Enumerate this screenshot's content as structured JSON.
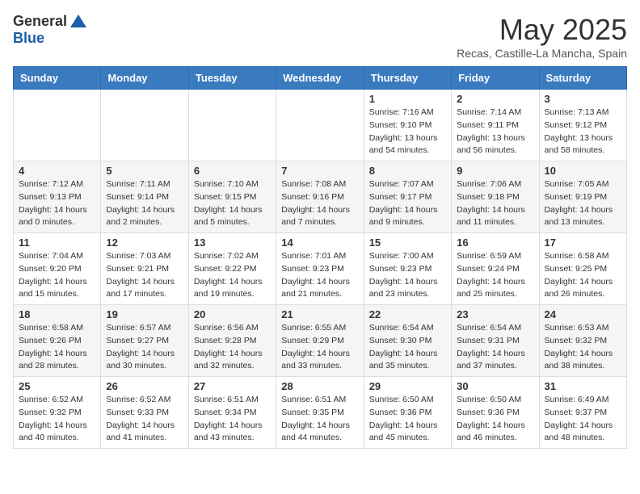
{
  "logo": {
    "general": "General",
    "blue": "Blue"
  },
  "title": "May 2025",
  "subtitle": "Recas, Castille-La Mancha, Spain",
  "days_of_week": [
    "Sunday",
    "Monday",
    "Tuesday",
    "Wednesday",
    "Thursday",
    "Friday",
    "Saturday"
  ],
  "weeks": [
    [
      {
        "day": "",
        "info": ""
      },
      {
        "day": "",
        "info": ""
      },
      {
        "day": "",
        "info": ""
      },
      {
        "day": "",
        "info": ""
      },
      {
        "day": "1",
        "sunrise": "7:16 AM",
        "sunset": "9:10 PM",
        "daylight": "13 hours and 54 minutes."
      },
      {
        "day": "2",
        "sunrise": "7:14 AM",
        "sunset": "9:11 PM",
        "daylight": "13 hours and 56 minutes."
      },
      {
        "day": "3",
        "sunrise": "7:13 AM",
        "sunset": "9:12 PM",
        "daylight": "13 hours and 58 minutes."
      }
    ],
    [
      {
        "day": "4",
        "sunrise": "7:12 AM",
        "sunset": "9:13 PM",
        "daylight": "14 hours and 0 minutes."
      },
      {
        "day": "5",
        "sunrise": "7:11 AM",
        "sunset": "9:14 PM",
        "daylight": "14 hours and 2 minutes."
      },
      {
        "day": "6",
        "sunrise": "7:10 AM",
        "sunset": "9:15 PM",
        "daylight": "14 hours and 5 minutes."
      },
      {
        "day": "7",
        "sunrise": "7:08 AM",
        "sunset": "9:16 PM",
        "daylight": "14 hours and 7 minutes."
      },
      {
        "day": "8",
        "sunrise": "7:07 AM",
        "sunset": "9:17 PM",
        "daylight": "14 hours and 9 minutes."
      },
      {
        "day": "9",
        "sunrise": "7:06 AM",
        "sunset": "9:18 PM",
        "daylight": "14 hours and 11 minutes."
      },
      {
        "day": "10",
        "sunrise": "7:05 AM",
        "sunset": "9:19 PM",
        "daylight": "14 hours and 13 minutes."
      }
    ],
    [
      {
        "day": "11",
        "sunrise": "7:04 AM",
        "sunset": "9:20 PM",
        "daylight": "14 hours and 15 minutes."
      },
      {
        "day": "12",
        "sunrise": "7:03 AM",
        "sunset": "9:21 PM",
        "daylight": "14 hours and 17 minutes."
      },
      {
        "day": "13",
        "sunrise": "7:02 AM",
        "sunset": "9:22 PM",
        "daylight": "14 hours and 19 minutes."
      },
      {
        "day": "14",
        "sunrise": "7:01 AM",
        "sunset": "9:23 PM",
        "daylight": "14 hours and 21 minutes."
      },
      {
        "day": "15",
        "sunrise": "7:00 AM",
        "sunset": "9:23 PM",
        "daylight": "14 hours and 23 minutes."
      },
      {
        "day": "16",
        "sunrise": "6:59 AM",
        "sunset": "9:24 PM",
        "daylight": "14 hours and 25 minutes."
      },
      {
        "day": "17",
        "sunrise": "6:58 AM",
        "sunset": "9:25 PM",
        "daylight": "14 hours and 26 minutes."
      }
    ],
    [
      {
        "day": "18",
        "sunrise": "6:58 AM",
        "sunset": "9:26 PM",
        "daylight": "14 hours and 28 minutes."
      },
      {
        "day": "19",
        "sunrise": "6:57 AM",
        "sunset": "9:27 PM",
        "daylight": "14 hours and 30 minutes."
      },
      {
        "day": "20",
        "sunrise": "6:56 AM",
        "sunset": "9:28 PM",
        "daylight": "14 hours and 32 minutes."
      },
      {
        "day": "21",
        "sunrise": "6:55 AM",
        "sunset": "9:29 PM",
        "daylight": "14 hours and 33 minutes."
      },
      {
        "day": "22",
        "sunrise": "6:54 AM",
        "sunset": "9:30 PM",
        "daylight": "14 hours and 35 minutes."
      },
      {
        "day": "23",
        "sunrise": "6:54 AM",
        "sunset": "9:31 PM",
        "daylight": "14 hours and 37 minutes."
      },
      {
        "day": "24",
        "sunrise": "6:53 AM",
        "sunset": "9:32 PM",
        "daylight": "14 hours and 38 minutes."
      }
    ],
    [
      {
        "day": "25",
        "sunrise": "6:52 AM",
        "sunset": "9:32 PM",
        "daylight": "14 hours and 40 minutes."
      },
      {
        "day": "26",
        "sunrise": "6:52 AM",
        "sunset": "9:33 PM",
        "daylight": "14 hours and 41 minutes."
      },
      {
        "day": "27",
        "sunrise": "6:51 AM",
        "sunset": "9:34 PM",
        "daylight": "14 hours and 43 minutes."
      },
      {
        "day": "28",
        "sunrise": "6:51 AM",
        "sunset": "9:35 PM",
        "daylight": "14 hours and 44 minutes."
      },
      {
        "day": "29",
        "sunrise": "6:50 AM",
        "sunset": "9:36 PM",
        "daylight": "14 hours and 45 minutes."
      },
      {
        "day": "30",
        "sunrise": "6:50 AM",
        "sunset": "9:36 PM",
        "daylight": "14 hours and 46 minutes."
      },
      {
        "day": "31",
        "sunrise": "6:49 AM",
        "sunset": "9:37 PM",
        "daylight": "14 hours and 48 minutes."
      }
    ]
  ],
  "labels": {
    "sunrise": "Sunrise: ",
    "sunset": "Sunset: ",
    "daylight": "Daylight: "
  }
}
